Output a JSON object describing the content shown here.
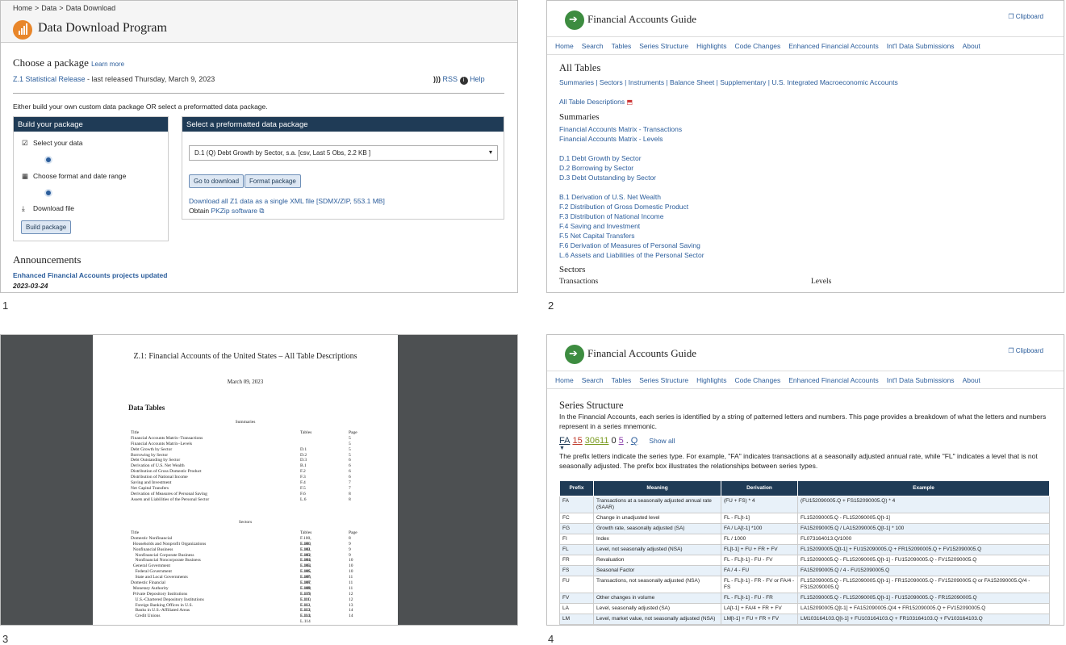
{
  "labels": {
    "p1": "1",
    "p2": "2",
    "p3": "3",
    "p4": "4"
  },
  "p1": {
    "crumb": [
      "Home",
      "Data",
      "Data Download"
    ],
    "title": "Data Download Program",
    "choose": "Choose a package",
    "learn": "Learn more",
    "release_link": "Z.1 Statistical Release",
    "release_text": " - last released Thursday, March 9, 2023",
    "rss": "RSS",
    "help": "Help",
    "either": "Either build your own custom data package OR select a preformatted data package.",
    "build_header": "Build your package",
    "steps": [
      "Select your data",
      "Choose format and date range",
      "Download file"
    ],
    "build_btn": "Build package",
    "pre_header": "Select a preformatted data package",
    "select_value": "D.1 (Q) Debt Growth by Sector, s.a. [csv, Last 5 Obs, 2.2 KB ]",
    "go_btn": "Go to download",
    "format_btn": "Format package",
    "download_all": "Download all Z1 data as a single XML file [SDMX/ZIP, 553.1 MB]",
    "obtain": "Obtain ",
    "pkzip": "PKZip software",
    "announcements": "Announcements",
    "enh": "Enhanced Financial Accounts projects updated",
    "date": "2023-03-24"
  },
  "guide": {
    "title": "Financial Accounts Guide",
    "clipboard": "Clipboard",
    "nav": [
      "Home",
      "Search",
      "Tables",
      "Series Structure",
      "Highlights",
      "Code Changes",
      "Enhanced Financial Accounts",
      "Int'l Data Submissions",
      "About"
    ]
  },
  "p2": {
    "heading": "All Tables",
    "links": "Summaries | Sectors | Instruments | Balance Sheet | Supplementary | U.S. Integrated Macroeconomic Accounts",
    "all_desc": "All Table Descriptions",
    "summaries": "Summaries",
    "g1": [
      "Financial Accounts Matrix - Transactions",
      "Financial Accounts Matrix - Levels"
    ],
    "g2": [
      "D.1 Debt Growth by Sector",
      "D.2 Borrowing by Sector",
      "D.3 Debt Outstanding by Sector"
    ],
    "g3": [
      "B.1 Derivation of U.S. Net Wealth",
      "F.2 Distribution of Gross Domestic Product",
      "F.3 Distribution of National Income",
      "F.4 Saving and Investment",
      "F.5 Net Capital Transfers",
      "F.6 Derivation of Measures of Personal Saving",
      "L.6 Assets and Liabilities of the Personal Sector"
    ],
    "sectors": "Sectors",
    "transactions": "Transactions",
    "levels": "Levels"
  },
  "p3": {
    "title": "Z.1: Financial Accounts of the United States – All Table Descriptions",
    "date": "March 09, 2023",
    "data_tables": "Data Tables",
    "summaries": "Summaries",
    "sectors": "Sectors",
    "head": [
      "Title",
      "Tables",
      "Page"
    ],
    "sum_rows": [
      [
        "Financial Accounts Matrix–Transactions",
        "",
        "5"
      ],
      [
        "Financial Accounts Matrix–Levels",
        "",
        "5"
      ],
      [
        "Debt Growth by Sector",
        "D.1",
        "5"
      ],
      [
        "Borrowing by Sector",
        "D.2",
        "5"
      ],
      [
        "Debt Outstanding by Sector",
        "D.3",
        "6"
      ],
      [
        "Derivation of U.S. Net Wealth",
        "B.1",
        "6"
      ],
      [
        "Distribution of Gross Domestic Product",
        "F.2",
        "6"
      ],
      [
        "Distribution of National Income",
        "F.3",
        "6"
      ],
      [
        "Saving and Investment",
        "F.4",
        "7"
      ],
      [
        "Net Capital Transfers",
        "F.5",
        "7"
      ],
      [
        "Derivation of Measures of Personal Saving",
        "F.6",
        "8"
      ],
      [
        "Assets and Liabilities of the Personal Sector",
        "L.6",
        "8"
      ]
    ],
    "sec_rows": [
      [
        "Domestic Nonfinancial",
        "F.100, L.100",
        "8"
      ],
      [
        "  Households and Nonprofit Organizations",
        "F.101, L.101",
        "9"
      ],
      [
        "  Nonfinancial Business",
        "F.102, L.102",
        "9"
      ],
      [
        "    Nonfinancial Corporate Business",
        "F.103, L.103",
        "9"
      ],
      [
        "    Nonfinancial Noncorporate Business",
        "F.104, L.104",
        "10"
      ],
      [
        "  General Government",
        "F.105, L.105",
        "10"
      ],
      [
        "    Federal Government",
        "F.106, L.106",
        "10"
      ],
      [
        "    State and Local Governments",
        "F.107, L.107",
        "11"
      ],
      [
        "Domestic Financial",
        "F.108, L.108",
        "11"
      ],
      [
        "  Monetary Authority",
        "F.109, L.109",
        "11"
      ],
      [
        "  Private Depository Institutions",
        "F.110, L.110",
        "12"
      ],
      [
        "    U.S.-Chartered Depository Institutions",
        "F.111, L.111",
        "12"
      ],
      [
        "    Foreign Banking Offices in U.S.",
        "F.112, L.112",
        "13"
      ],
      [
        "    Banks in U.S.-Affiliated Areas",
        "F.113, L.113",
        "14"
      ],
      [
        "    Credit Unions",
        "F.114, L.114",
        "14"
      ]
    ]
  },
  "p4": {
    "heading": "Series Structure",
    "intro": "In the Financial Accounts, each series is identified by a string of patterned letters and numbers. This page provides a breakdown of what the letters and numbers represent in a series mnemonic.",
    "mnemonic": [
      "FA",
      "15",
      "30611",
      "0",
      "5",
      ".",
      "Q"
    ],
    "show_all": "Show all",
    "prefix_text": "The prefix letters indicate the series type. For example, \"FA\" indicates transactions at a seasonally adjusted annual rate, while \"FL\" indicates a level that is not seasonally adjusted. The prefix box illustrates the relationships between series types.",
    "columns": [
      "Prefix",
      "Meaning",
      "Derivation",
      "Example"
    ],
    "rows": [
      [
        "FA",
        "Transactions at a seasonally adjusted annual rate (SAAR)",
        "(FU + FS) * 4",
        "(FU152090005.Q + FS152090005.Q) * 4"
      ],
      [
        "FC",
        "Change in unadjusted level",
        "FL - FL[t-1]",
        "FL152090005.Q - FL152090005.Q[t-1]"
      ],
      [
        "FG",
        "Growth rate, seasonally adjusted (SA)",
        "FA / LA[t-1] *100",
        "FA152090005.Q / LA152090005.Q[t-1] * 100"
      ],
      [
        "FI",
        "Index",
        "FL / 1000",
        "FL073164013.Q/1000"
      ],
      [
        "FL",
        "Level, not seasonally adjusted (NSA)",
        "FL[t-1] + FU + FR + FV",
        "FL152090005.Q[t-1] + FU152090005.Q + FR152090005.Q + FV152090005.Q"
      ],
      [
        "FR",
        "Revaluation",
        "FL - FL[t-1] - FU - FV",
        "FL152090005.Q - FL152090005.Q[t-1] - FU152090005.Q - FV152090005.Q"
      ],
      [
        "FS",
        "Seasonal Factor",
        "FA / 4 - FU",
        "FA152090005.Q / 4 - FU152090005.Q"
      ],
      [
        "FU",
        "Transactions, not seasonally adjusted (NSA)",
        "FL - FL[t-1] - FR - FV or FA/4 - FS",
        "FL152090005.Q - FL152090005.Q[t-1] - FR152090005.Q - FV152090005.Q or FA152090005.Q/4 - FS152090005.Q"
      ],
      [
        "FV",
        "Other changes in volume",
        "FL - FL[t-1] - FU - FR",
        "FL152090005.Q - FL152090005.Q[t-1] - FU152090005.Q - FR152090005.Q"
      ],
      [
        "LA",
        "Level, seasonally adjusted (SA)",
        "LA[t-1] + FA/4 + FR + FV",
        "LA152090005.Q[t-1] + FA152090005.Q/4 + FR152090005.Q + FV152090005.Q"
      ],
      [
        "LM",
        "Level, market value, not seasonally adjusted (NSA)",
        "LM[t-1] + FU + FR + FV",
        "LM103164103.Q[t-1] + FU103164103.Q + FR103164103.Q + FV103164103.Q"
      ]
    ]
  }
}
